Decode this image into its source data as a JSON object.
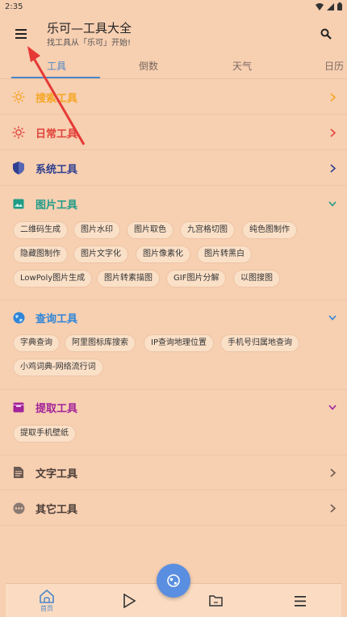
{
  "status_bar": {
    "time": "2:35"
  },
  "app": {
    "title": "乐可—工具大全",
    "subtitle": "找工具从「乐可」开始!"
  },
  "tabs": [
    {
      "label": "工具"
    },
    {
      "label": "倒数"
    },
    {
      "label": "天气"
    },
    {
      "label": "日历"
    }
  ],
  "categories": {
    "search": {
      "label": "搜索工具",
      "color": "#f5a623"
    },
    "daily": {
      "label": "日常工具",
      "color": "#e0443b"
    },
    "system": {
      "label": "系统工具",
      "color": "#2e3f8f"
    },
    "image": {
      "label": "图片工具",
      "color": "#1f9c86"
    },
    "query": {
      "label": "查询工具",
      "color": "#2f86d8"
    },
    "extract": {
      "label": "提取工具",
      "color": "#a2229a"
    },
    "text": {
      "label": "文字工具",
      "color": "#6b5a52"
    },
    "other": {
      "label": "其它工具",
      "color": "#6b5a52"
    }
  },
  "image_tools": [
    "二维码生成",
    "图片水印",
    "图片取色",
    "九宫格切图",
    "纯色图制作",
    "隐藏图制作",
    "图片文字化",
    "图片像素化",
    "图片转黑白",
    "LowPoly图片生成",
    "图片转素描图",
    "GIF图片分解",
    "以图搜图"
  ],
  "query_tools": [
    "字典查询",
    "阿里图标库搜索",
    "IP查询地理位置",
    "手机号归属地查询",
    "小鸡词典-网络流行词"
  ],
  "extract_tools": [
    "提取手机壁纸"
  ],
  "bottom_nav": {
    "home_label": "首页"
  },
  "theme": {
    "accent": "#4b86c7",
    "background": "#f7cfb1",
    "annotation_arrow": "#e53935"
  }
}
